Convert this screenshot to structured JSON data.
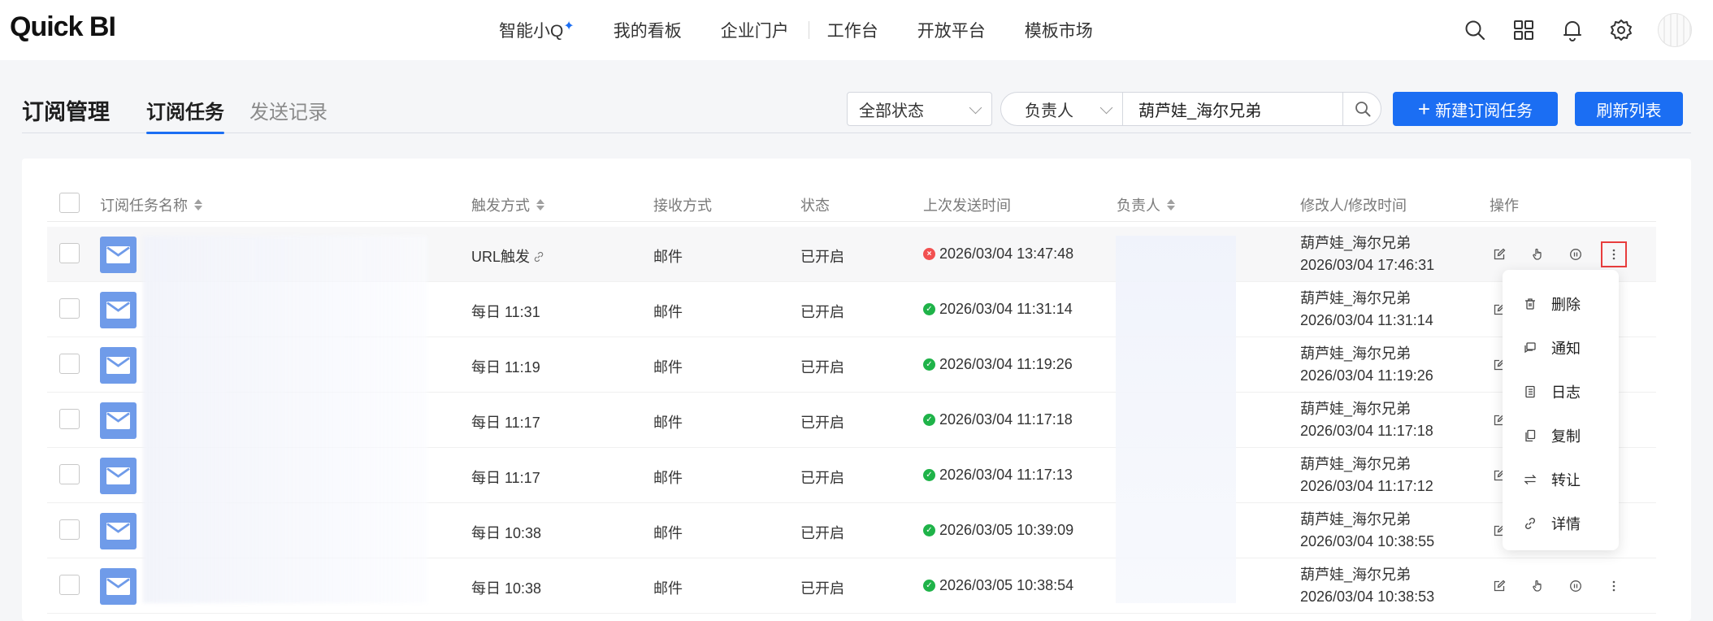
{
  "app": {
    "logo": "Quick BI"
  },
  "nav": {
    "items": [
      "智能小Q",
      "我的看板",
      "企业门户",
      "工作台",
      "开放平台",
      "模板市场"
    ],
    "spark": "✦"
  },
  "header": {
    "title": "订阅管理",
    "tabs": [
      {
        "label": "订阅任务",
        "active": true
      },
      {
        "label": "发送记录",
        "active": false
      }
    ]
  },
  "filters": {
    "status": "全部状态",
    "owner_label": "负责人",
    "owner_value": "葫芦娃_海尔兄弟"
  },
  "buttons": {
    "new_task": "新建订阅任务",
    "new_plus": "+",
    "refresh": "刷新列表"
  },
  "table": {
    "columns": [
      "订阅任务名称",
      "触发方式",
      "接收方式",
      "状态",
      "上次发送时间",
      "负责人",
      "修改人/修改时间",
      "操作"
    ],
    "rows": [
      {
        "trigger": "URL触发",
        "receive": "邮件",
        "status": "已开启",
        "last_sent": "2026/03/04 13:47:48",
        "last_ok": false,
        "modifier": "葫芦娃_海尔兄弟",
        "modified": "2026/03/04 17:46:31"
      },
      {
        "trigger": "每日 11:31",
        "receive": "邮件",
        "status": "已开启",
        "last_sent": "2026/03/04 11:31:14",
        "last_ok": true,
        "modifier": "葫芦娃_海尔兄弟",
        "modified": "2026/03/04 11:31:14"
      },
      {
        "trigger": "每日 11:19",
        "receive": "邮件",
        "status": "已开启",
        "last_sent": "2026/03/04 11:19:26",
        "last_ok": true,
        "modifier": "葫芦娃_海尔兄弟",
        "modified": "2026/03/04 11:19:26"
      },
      {
        "trigger": "每日 11:17",
        "receive": "邮件",
        "status": "已开启",
        "last_sent": "2026/03/04 11:17:18",
        "last_ok": true,
        "modifier": "葫芦娃_海尔兄弟",
        "modified": "2026/03/04 11:17:18"
      },
      {
        "trigger": "每日 11:17",
        "receive": "邮件",
        "status": "已开启",
        "last_sent": "2026/03/04 11:17:13",
        "last_ok": true,
        "modifier": "葫芦娃_海尔兄弟",
        "modified": "2026/03/04 11:17:12"
      },
      {
        "trigger": "每日 10:38",
        "receive": "邮件",
        "status": "已开启",
        "last_sent": "2026/03/05 10:39:09",
        "last_ok": true,
        "modifier": "葫芦娃_海尔兄弟",
        "modified": "2026/03/04 10:38:55"
      },
      {
        "trigger": "每日 10:38",
        "receive": "邮件",
        "status": "已开启",
        "last_sent": "2026/03/05 10:38:54",
        "last_ok": true,
        "modifier": "葫芦娃_海尔兄弟",
        "modified": "2026/03/04 10:38:53"
      }
    ]
  },
  "more_menu": {
    "items": [
      "删除",
      "通知",
      "日志",
      "复制",
      "转让",
      "详情"
    ]
  },
  "colors": {
    "primary": "#1b6ef3",
    "success": "#1fb349",
    "error": "#f25050",
    "mail_icon": "#6f9be9"
  }
}
